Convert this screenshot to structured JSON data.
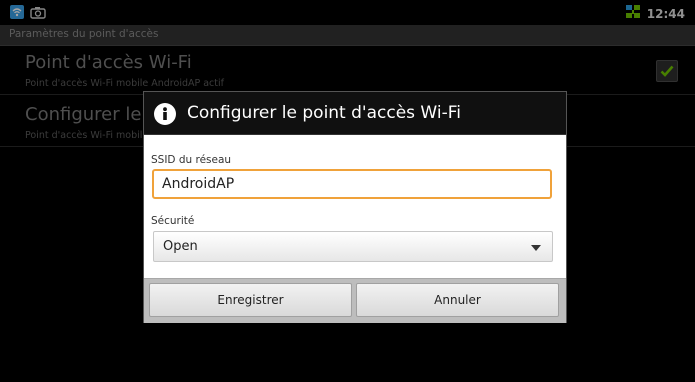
{
  "status_bar": {
    "left_icons": [
      "wifi-hotspot-icon",
      "camera-icon"
    ],
    "right_icons": [
      "network-status-icon"
    ],
    "time": "12:44"
  },
  "header": {
    "title": "Paramètres du point d'accès"
  },
  "preferences": [
    {
      "title": "Point d'accès Wi-Fi",
      "summary": "Point d'accès Wi-Fi mobile AndroidAP actif",
      "checked": true
    },
    {
      "title": "Configurer le point d'accès Wi-Fi",
      "summary": "Point d'accès Wi-Fi mobile AndroidAP actif"
    }
  ],
  "dialog": {
    "icon": "info-icon",
    "title": "Configurer le point d'accès Wi-Fi",
    "ssid_label": "SSID du réseau",
    "ssid_value": "AndroidAP",
    "security_label": "Sécurité",
    "security_value": "Open",
    "save_label": "Enregistrer",
    "cancel_label": "Annuler"
  },
  "colors": {
    "accent_focus": "#f0a23a",
    "check_green": "#6fc400",
    "hotspot_blue": "#3aa0e6"
  }
}
